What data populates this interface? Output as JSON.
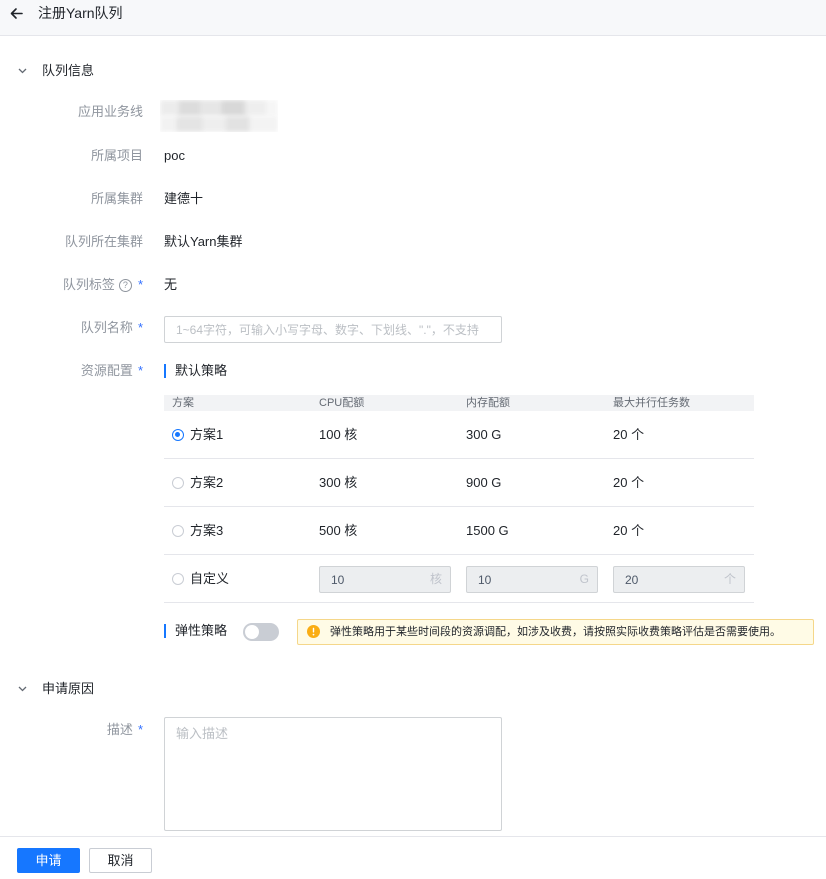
{
  "header": {
    "title": "注册Yarn队列",
    "back_icon": "arrow-left-icon"
  },
  "sections": {
    "queue_info": {
      "title": "队列信息",
      "icon": "chevron-down-icon"
    },
    "apply_reason": {
      "title": "申请原因",
      "icon": "chevron-down-icon"
    }
  },
  "required_mark": "*",
  "help_mark": "?",
  "form": {
    "business_line": {
      "label": "应用业务线"
    },
    "project": {
      "label": "所属项目",
      "value": "poc"
    },
    "cluster": {
      "label": "所属集群",
      "value": "建德十"
    },
    "queue_cluster": {
      "label": "队列所在集群",
      "value": "默认Yarn集群"
    },
    "queue_tag": {
      "label": "队列标签",
      "value": "无"
    },
    "queue_name": {
      "label": "队列名称",
      "placeholder": "1~64字符，可输入小写字母、数字、下划线、\".\"，不支持"
    },
    "resource": {
      "label": "资源配置",
      "policy_title": "默认策略"
    },
    "description": {
      "label": "描述",
      "placeholder": "输入描述"
    }
  },
  "resource_table": {
    "columns": [
      "方案",
      "CPU配额",
      "内存配额",
      "最大并行任务数"
    ],
    "rows": [
      {
        "name": "方案1",
        "cpu": "100 核",
        "memory": "300 G",
        "max_tasks": "20 个",
        "selected": true
      },
      {
        "name": "方案2",
        "cpu": "300 核",
        "memory": "900 G",
        "max_tasks": "20 个",
        "selected": false
      },
      {
        "name": "方案3",
        "cpu": "500 核",
        "memory": "1500 G",
        "max_tasks": "20 个",
        "selected": false
      }
    ],
    "custom": {
      "name": "自定义",
      "selected": false,
      "cpu": {
        "value": "10",
        "unit": "核"
      },
      "memory": {
        "value": "10",
        "unit": "G"
      },
      "max_tasks": {
        "value": "20",
        "unit": "个"
      }
    }
  },
  "elastic": {
    "label": "弹性策略",
    "enabled": false,
    "warning_icon": "warning-circle-icon",
    "warning": "弹性策略用于某些时间段的资源调配，如涉及收费，请按照实际收费策略评估是否需要使用。"
  },
  "footer": {
    "submit_label": "申请",
    "cancel_label": "取消"
  },
  "colors": {
    "primary": "#1677ff",
    "required": "#3370ff",
    "warning_icon": "#faad14",
    "warning_bg": "#fffbe6",
    "label": "#8f959e",
    "text": "#1f2329"
  }
}
